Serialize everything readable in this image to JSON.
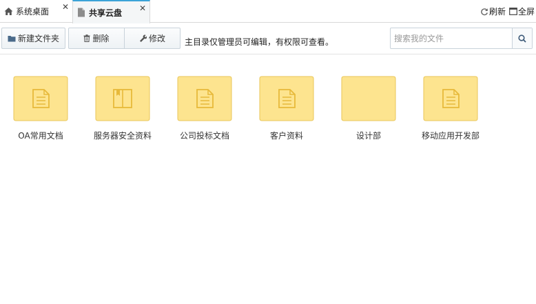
{
  "tabs": [
    {
      "label": "系统桌面",
      "icon": "home-icon",
      "close": "✕"
    },
    {
      "label": "共享云盘",
      "icon": "document-icon",
      "close": "✕"
    }
  ],
  "header_actions": {
    "refresh_label": "刷新",
    "fullscreen_label": "全屏"
  },
  "toolbar": {
    "new_folder_label": "新建文件夹",
    "delete_label": "删除",
    "edit_label": "修改",
    "notice": "主目录仅管理员可编辑，有权限可查看。"
  },
  "search": {
    "placeholder": "搜索我的文件",
    "value": ""
  },
  "folders": [
    {
      "name": "OA常用文档",
      "icon": "document-icon"
    },
    {
      "name": "服务器安全资料",
      "icon": "book-icon"
    },
    {
      "name": "公司投标文档",
      "icon": "document-icon"
    },
    {
      "name": "客户资料",
      "icon": "document-icon"
    },
    {
      "name": "设计部",
      "icon": "none"
    },
    {
      "name": "移动应用开发部",
      "icon": "document-icon"
    }
  ],
  "colors": {
    "folder_fill": "#fde48f",
    "folder_stroke": "#e9c65a",
    "folder_glyph": "#e7b93a",
    "tab_accent": "#3ba3d8"
  }
}
